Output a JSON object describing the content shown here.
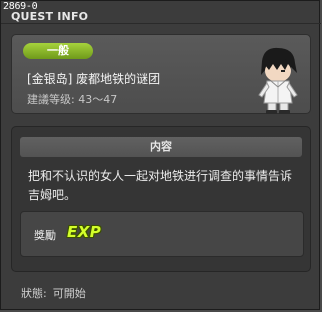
{
  "window": {
    "id_label": "2869-0",
    "title": "QUEST INFO"
  },
  "quest": {
    "category": "一般",
    "name": "[金银岛] 废都地铁的谜团",
    "level_label": "建議等级: 43～47",
    "npc_icon": "npc-portrait-icon"
  },
  "content": {
    "header": "内容",
    "text": "把和不认识的女人一起对地铁进行调查的事情告诉吉姆吧。"
  },
  "reward": {
    "label": "獎勵",
    "exp_label": "EXP"
  },
  "status": {
    "label": "狀態:",
    "value": "可開始"
  },
  "colors": {
    "badge_green": "#8cbf2a",
    "exp_green": "#d4ff2a"
  }
}
